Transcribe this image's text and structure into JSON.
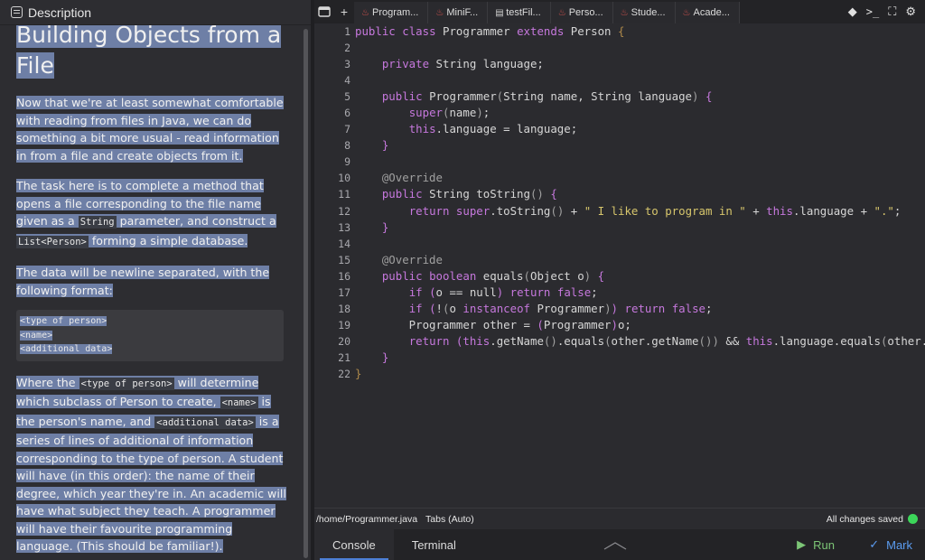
{
  "left_panel": {
    "header": "Description",
    "title": "Building Objects from a File",
    "para1": "Now that we're at least somewhat comfortable with reading from files in Java, we can do something a bit more usual - read information in from a file and create objects from it.",
    "para2_pre": "The task here is to complete a method that opens a file corresponding to the file name given as a ",
    "para2_code1": "String",
    "para2_mid": " parameter, and construct a ",
    "para2_code2": "List<Person>",
    "para2_post": " forming a simple database.",
    "para3": "The data will be newline separated, with the following format:",
    "format_lines": [
      "<type of person>",
      "<name>",
      "<additional data>"
    ],
    "para4_a": "Where the ",
    "para4_code1": "<type of person>",
    "para4_b": " will determine which subclass of Person to create, ",
    "para4_code2": "<name>",
    "para4_c": " is the person's name, and ",
    "para4_code3": "<additional data>",
    "para4_d": " is a series of lines of additional of information corresponding to the type of person. A student will have (in this order): the name of their degree, which year they're in. An academic will have what subject they teach. A programmer will have their favourite programming language. (This should be familiar!)."
  },
  "tabs": [
    {
      "label": "Program...",
      "icon": "java-icon",
      "active": true
    },
    {
      "label": "MiniF...",
      "icon": "java-icon",
      "active": false
    },
    {
      "label": "testFil...",
      "icon": "file-icon",
      "active": false
    },
    {
      "label": "Perso...",
      "icon": "java-icon",
      "active": false
    },
    {
      "label": "Stude...",
      "icon": "java-icon",
      "active": false
    },
    {
      "label": "Acade...",
      "icon": "java-icon",
      "active": false
    }
  ],
  "editor": {
    "line_numbers": [
      "1",
      "2",
      "3",
      "4",
      "5",
      "6",
      "7",
      "8",
      "9",
      "10",
      "11",
      "12",
      "13",
      "14",
      "15",
      "16",
      "17",
      "18",
      "19",
      "20",
      "21",
      "22"
    ]
  },
  "status": {
    "path": "/home/Programmer.java",
    "tabs_mode": "Tabs (Auto)",
    "saved": "All changes saved"
  },
  "bottom": {
    "console": "Console",
    "terminal": "Terminal",
    "run": "Run",
    "mark": "Mark"
  }
}
